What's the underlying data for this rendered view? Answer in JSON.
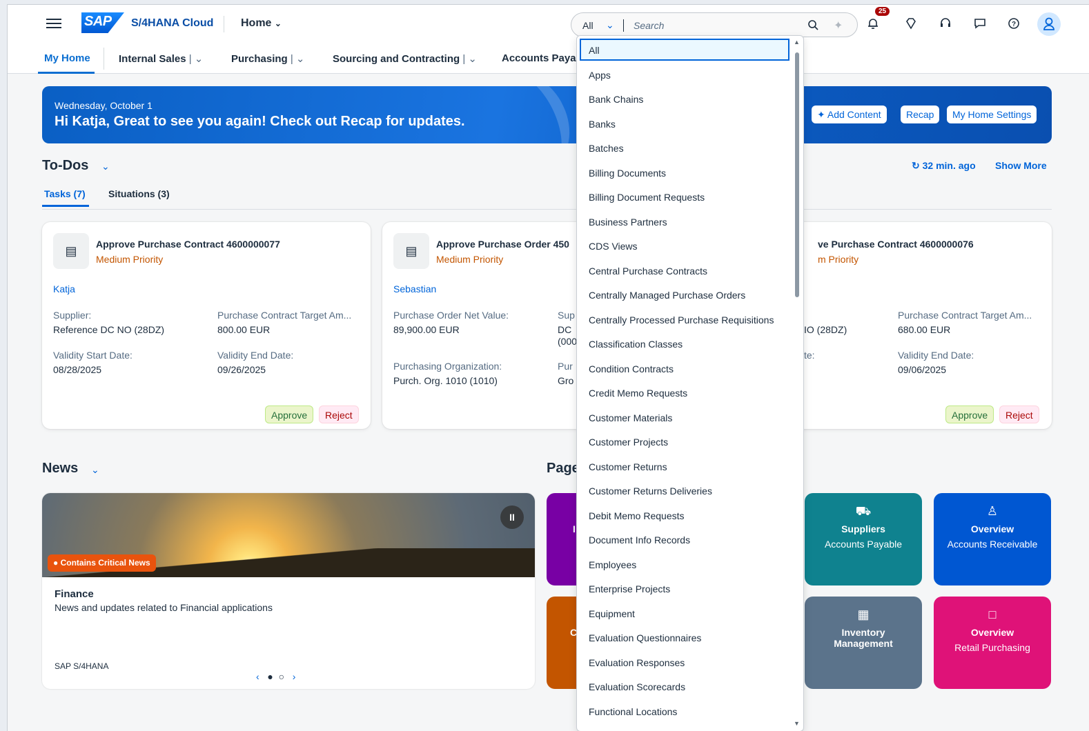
{
  "shell": {
    "product": "S/4HANA Cloud",
    "logo": "SAP",
    "home_menu": "Home",
    "search_scope": "All",
    "search_placeholder": "Search",
    "notifications_count": "25"
  },
  "nav": {
    "items": [
      {
        "label": "My Home"
      },
      {
        "label": "Internal Sales"
      },
      {
        "label": "Purchasing"
      },
      {
        "label": "Sourcing and Contracting"
      },
      {
        "label": "Accounts Payab"
      }
    ]
  },
  "banner": {
    "date": "Wednesday, October 1",
    "greeting": "Hi Katja, Great to see you again! Check out Recap for updates.",
    "buttons": [
      "Add Content",
      "Recap",
      "My Home Settings"
    ]
  },
  "todos": {
    "title": "To-Dos",
    "refresh": "32 min. ago",
    "show_more": "Show More",
    "tabs": [
      "Tasks (7)",
      "Situations (3)"
    ],
    "cards": [
      {
        "title": "Approve Purchase Contract 4600000077",
        "priority": "Medium Priority",
        "person": "Katja",
        "f1_label": "Supplier:",
        "f1_value": "Reference DC NO (28DZ)",
        "f2_label": "Purchase Contract Target Am...",
        "f2_value": "800.00 EUR",
        "f3_label": "Validity Start Date:",
        "f3_value": "08/28/2025",
        "f4_label": "Validity End Date:",
        "f4_value": "09/26/2025",
        "approve": "Approve",
        "reject": "Reject"
      },
      {
        "title": "Approve Purchase Order 450",
        "priority": "Medium Priority",
        "person": "Sebastian",
        "f1_label": "Purchase Order Net Value:",
        "f1_value": "89,900.00 EUR",
        "f2_label": "Sup",
        "f2_value": "DC",
        "f2_value2": "(000",
        "f3_label": "Purchasing Organization:",
        "f3_value": "Purch. Org. 1010 (1010)",
        "f4_label": "Pur",
        "f4_value": "Gro"
      },
      {
        "title": "ve Purchase Contract 4600000076",
        "priority": "m Priority",
        "f1_value": "IO (28DZ)",
        "f2_label": "Purchase Contract Target Am...",
        "f2_value": "680.00 EUR",
        "f3_label": "te:",
        "f4_label": "Validity End Date:",
        "f4_value": "09/06/2025",
        "approve": "Approve",
        "reject": "Reject"
      }
    ]
  },
  "news": {
    "title": "News",
    "badge": "Contains Critical News",
    "item_title": "Finance",
    "item_desc": "News and updates related to Financial applications",
    "source": "SAP S/4HANA"
  },
  "pages": {
    "title": "Page",
    "tiles": [
      {
        "icon": "truck-icon",
        "title": "Suppliers",
        "subtitle": "Accounts Payable",
        "color": "#0f828f"
      },
      {
        "icon": "person-list-icon",
        "title": "Overview",
        "subtitle": "Accounts Receivable",
        "color": "#0057d2"
      },
      {
        "icon": "building-icon",
        "title": "Inventory Management",
        "subtitle": "",
        "color": "#5b738b"
      },
      {
        "icon": "document-icon",
        "title": "Overview",
        "subtitle": "Retail Purchasing",
        "color": "#df1278"
      },
      {
        "partial": "I",
        "color": "#7800a4"
      },
      {
        "partial": "C",
        "color": "#c35500"
      }
    ]
  },
  "dropdown": {
    "items": [
      "All",
      "Apps",
      "Bank Chains",
      "Banks",
      "Batches",
      "Billing Documents",
      "Billing Document Requests",
      "Business Partners",
      "CDS Views",
      "Central Purchase Contracts",
      "Centrally Managed Purchase Orders",
      "Centrally Processed Purchase Requisitions",
      "Classification Classes",
      "Condition Contracts",
      "Credit Memo Requests",
      "Customer Materials",
      "Customer Projects",
      "Customer Returns",
      "Customer Returns Deliveries",
      "Debit Memo Requests",
      "Document Info Records",
      "Employees",
      "Enterprise Projects",
      "Equipment",
      "Evaluation Questionnaires",
      "Evaluation Responses",
      "Evaluation Scorecards",
      "Functional Locations"
    ],
    "selected": "All"
  }
}
